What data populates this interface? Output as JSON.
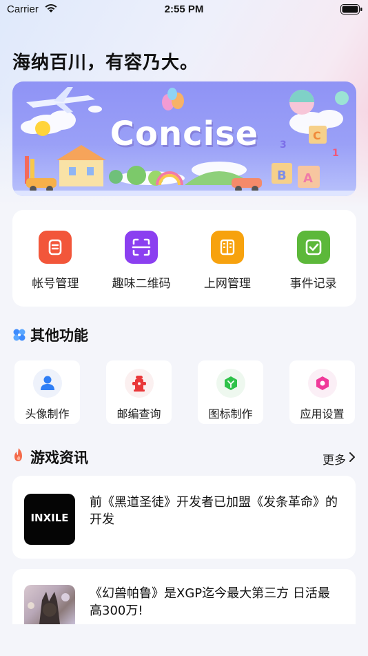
{
  "status_bar": {
    "carrier": "Carrier",
    "time": "2:55 PM"
  },
  "headline": "海纳百川，有容乃大。",
  "banner": {
    "title": "Concise"
  },
  "quick_actions": [
    {
      "label": "帐号管理",
      "icon": "document-icon",
      "color": "#f2563a"
    },
    {
      "label": "趣味二维码",
      "icon": "scan-icon",
      "color": "#8b3ff0"
    },
    {
      "label": "上网管理",
      "icon": "server-icon",
      "color": "#f7a20e"
    },
    {
      "label": "事件记录",
      "icon": "checkbox-icon",
      "color": "#5cb83a"
    }
  ],
  "other_section": {
    "title": "其他功能"
  },
  "other_functions": [
    {
      "label": "头像制作",
      "icon": "user-icon",
      "color": "#2f7ef5"
    },
    {
      "label": "邮编查询",
      "icon": "hydrant-icon",
      "color": "#e9383a"
    },
    {
      "label": "图标制作",
      "icon": "cube-icon",
      "color": "#2fc24a"
    },
    {
      "label": "应用设置",
      "icon": "settings-hexagon-icon",
      "color": "#f03a9a"
    }
  ],
  "news_section": {
    "title": "游戏资讯",
    "more": "更多"
  },
  "news": [
    {
      "title": "前《黑道圣徒》开发者已加盟《发条革命》的开发",
      "thumb_text": "INXILE"
    },
    {
      "title": "《幻兽帕鲁》是XGP迄今最大第三方 日活最高300万!"
    }
  ]
}
